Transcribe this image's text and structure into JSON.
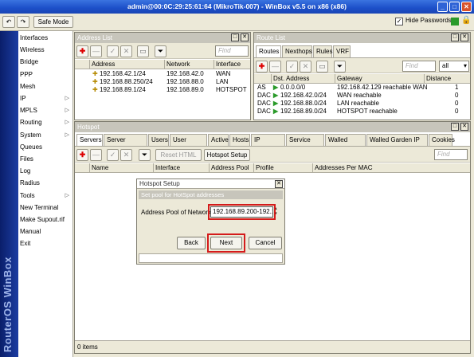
{
  "window": {
    "title": "admin@00:0C:29:25:61:64 (MikroTik-007) - WinBox v5.5 on x86 (x86)"
  },
  "toolbar": {
    "safe_mode": "Safe Mode",
    "hide_passwords": "Hide Passwords"
  },
  "sidebar": {
    "brand": "RouterOS WinBox",
    "items": [
      {
        "label": "Interfaces",
        "sub": false
      },
      {
        "label": "Wireless",
        "sub": false
      },
      {
        "label": "Bridge",
        "sub": false
      },
      {
        "label": "PPP",
        "sub": false
      },
      {
        "label": "Mesh",
        "sub": false
      },
      {
        "label": "IP",
        "sub": true
      },
      {
        "label": "MPLS",
        "sub": true
      },
      {
        "label": "Routing",
        "sub": true
      },
      {
        "label": "System",
        "sub": true
      },
      {
        "label": "Queues",
        "sub": false
      },
      {
        "label": "Files",
        "sub": false
      },
      {
        "label": "Log",
        "sub": false
      },
      {
        "label": "Radius",
        "sub": false
      },
      {
        "label": "Tools",
        "sub": true
      },
      {
        "label": "New Terminal",
        "sub": false
      },
      {
        "label": "Make Supout.rif",
        "sub": false
      },
      {
        "label": "Manual",
        "sub": false
      },
      {
        "label": "Exit",
        "sub": false
      }
    ],
    "sub_arrow": "▷"
  },
  "address_list": {
    "title": "Address List",
    "find_placeholder": "Find",
    "columns": [
      "Address",
      "Network",
      "Interface"
    ],
    "rows": [
      {
        "address": "192.168.42.1/24",
        "network": "192.168.42.0",
        "interface": "WAN"
      },
      {
        "address": "192.168.88.250/24",
        "network": "192.168.88.0",
        "interface": "LAN"
      },
      {
        "address": "192.168.89.1/24",
        "network": "192.168.89.0",
        "interface": "HOTSPOT"
      }
    ]
  },
  "route_list": {
    "title": "Route List",
    "tabs": [
      "Routes",
      "Nexthops",
      "Rules",
      "VRF"
    ],
    "find_placeholder": "Find",
    "filter_value": "all",
    "columns": [
      "Dst. Address",
      "Gateway",
      "Distance"
    ],
    "rows": [
      {
        "flags": "AS",
        "dst": "0.0.0.0/0",
        "gateway": "192.168.42.129 reachable WAN",
        "distance": "1"
      },
      {
        "flags": "DAC",
        "dst": "192.168.42.0/24",
        "gateway": "WAN reachable",
        "distance": "0"
      },
      {
        "flags": "DAC",
        "dst": "192.168.88.0/24",
        "gateway": "LAN reachable",
        "distance": "0"
      },
      {
        "flags": "DAC",
        "dst": "192.168.89.0/24",
        "gateway": "HOTSPOT reachable",
        "distance": "0"
      }
    ]
  },
  "hotspot": {
    "title": "Hotspot",
    "tabs": [
      "Servers",
      "Server Profiles",
      "Users",
      "User Profiles",
      "Active",
      "Hosts",
      "IP Bindings",
      "Service Ports",
      "Walled Garden",
      "Walled Garden IP List",
      "Cookies"
    ],
    "reset_html": "Reset HTML",
    "hotspot_setup": "Hotspot Setup",
    "find_placeholder": "Find",
    "columns": [
      "Name",
      "Interface",
      "Address Pool",
      "Profile",
      "Addresses Per MAC"
    ],
    "status": "0 items"
  },
  "dialog": {
    "title": "Hotspot Setup",
    "subtitle": "Set pool for HotSpot addresses",
    "field_label": "Address Pool of Network:",
    "field_value": "192.168.89.200-192.1",
    "back": "Back",
    "next": "Next",
    "cancel": "Cancel"
  },
  "colors": {
    "title_bar": "#1c4fc8",
    "sidebar": "#0a1e6a",
    "highlight": "#d41b1b",
    "panel_header": "#c7c5bb"
  }
}
